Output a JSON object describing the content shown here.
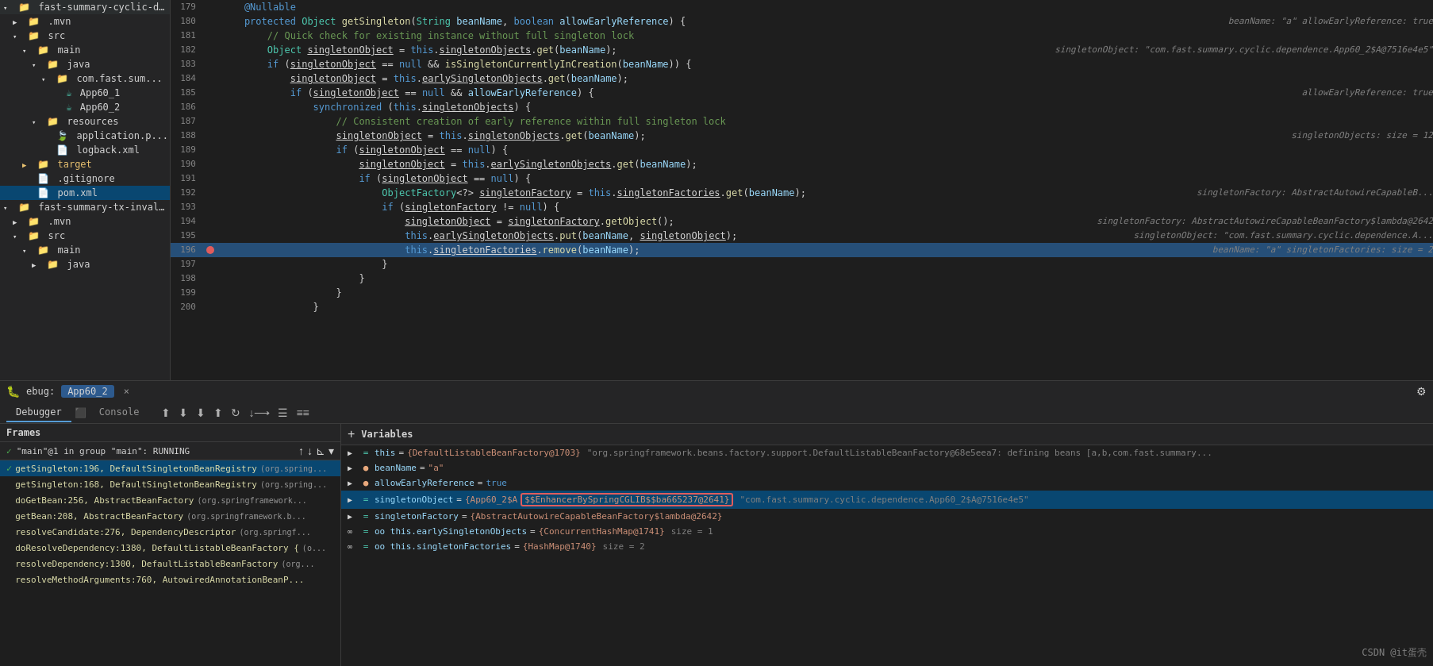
{
  "sidebar": {
    "items": [
      {
        "id": "fast-summary-cyclic",
        "label": "fast-summary-cyclic-de...",
        "indent": 0,
        "type": "folder",
        "expanded": true,
        "color": "orange"
      },
      {
        "id": "mvn1",
        "label": ".mvn",
        "indent": 1,
        "type": "folder",
        "expanded": false
      },
      {
        "id": "src1",
        "label": "src",
        "indent": 1,
        "type": "folder",
        "expanded": true
      },
      {
        "id": "main1",
        "label": "main",
        "indent": 2,
        "type": "folder",
        "expanded": true
      },
      {
        "id": "java1",
        "label": "java",
        "indent": 3,
        "type": "folder",
        "expanded": true
      },
      {
        "id": "com.fast.sum",
        "label": "com.fast.sum...",
        "indent": 4,
        "type": "folder",
        "expanded": true
      },
      {
        "id": "App60_1",
        "label": "App60_1",
        "indent": 5,
        "type": "java"
      },
      {
        "id": "App60_2",
        "label": "App60_2",
        "indent": 5,
        "type": "java"
      },
      {
        "id": "resources",
        "label": "resources",
        "indent": 3,
        "type": "folder",
        "expanded": true
      },
      {
        "id": "application.p",
        "label": "application.p...",
        "indent": 4,
        "type": "prop"
      },
      {
        "id": "logback.xml",
        "label": "logback.xml",
        "indent": 4,
        "type": "xml"
      },
      {
        "id": "target",
        "label": "target",
        "indent": 2,
        "type": "folder-orange",
        "expanded": false
      },
      {
        "id": "gitignore",
        "label": ".gitignore",
        "indent": 2,
        "type": "file"
      },
      {
        "id": "pom.xml",
        "label": "pom.xml",
        "indent": 2,
        "type": "maven",
        "selected": true
      },
      {
        "id": "fast-summary-tx-invalid",
        "label": "fast-summary-tx-invali...",
        "indent": 0,
        "type": "folder",
        "expanded": true
      },
      {
        "id": "mvn2",
        "label": ".mvn",
        "indent": 1,
        "type": "folder"
      },
      {
        "id": "src2",
        "label": "src",
        "indent": 1,
        "type": "folder",
        "expanded": true
      },
      {
        "id": "main2",
        "label": "main",
        "indent": 2,
        "type": "folder",
        "expanded": true
      },
      {
        "id": "java2",
        "label": "java",
        "indent": 3,
        "type": "folder",
        "expanded": false
      }
    ]
  },
  "code": {
    "lines": [
      {
        "num": 179,
        "content": "    @Nullable",
        "type": "annotation",
        "highlighted": false
      },
      {
        "num": 180,
        "content": "    protected Object getSingleton(String beanName, boolean allowEarlyReference) {",
        "highlighted": false,
        "hint": "  beanName: \"a\"    allowEarlyReference: true"
      },
      {
        "num": 181,
        "content": "        // Quick check for existing instance without full singleton lock",
        "highlighted": false
      },
      {
        "num": 182,
        "content": "        Object singletonObject = this.singletonObjects.get(beanName);",
        "highlighted": false,
        "hint": "  singletonObject: \"com.fast.summary.cyclic.dependence.App60_2$A@7516e4e5\""
      },
      {
        "num": 183,
        "content": "        if (singletonObject == null && isSingletonCurrentlyInCreation(beanName)) {",
        "highlighted": false
      },
      {
        "num": 184,
        "content": "            singletonObject = this.earlySingletonObjects.get(beanName);",
        "highlighted": false
      },
      {
        "num": 185,
        "content": "            if (singletonObject == null && allowEarlyReference) {",
        "highlighted": false,
        "hint": "  allowEarlyReference: true"
      },
      {
        "num": 186,
        "content": "                synchronized (this.singletonObjects) {",
        "highlighted": false
      },
      {
        "num": 187,
        "content": "                    // Consistent creation of early reference within full singleton lock",
        "highlighted": false
      },
      {
        "num": 188,
        "content": "                    singletonObject = this.singletonObjects.get(beanName);",
        "highlighted": false,
        "hint": "  singletonObjects:  size = 12"
      },
      {
        "num": 189,
        "content": "                    if (singletonObject == null) {",
        "highlighted": false
      },
      {
        "num": 190,
        "content": "                        singletonObject = this.earlySingletonObjects.get(beanName);",
        "highlighted": false
      },
      {
        "num": 191,
        "content": "                        if (singletonObject == null) {",
        "highlighted": false
      },
      {
        "num": 192,
        "content": "                            ObjectFactory<?> singletonFactory = this.singletonFactories.get(beanName);",
        "highlighted": false,
        "hint": "  singletonFactory: AbstractAutowireCapableB"
      },
      {
        "num": 193,
        "content": "                            if (singletonFactory != null) {",
        "highlighted": false
      },
      {
        "num": 194,
        "content": "                                singletonObject = singletonFactory.getObject();",
        "highlighted": false,
        "hint": "  singletonFactory: AbstractAutowireCapableBeanFactory$lambda@2642"
      },
      {
        "num": 195,
        "content": "                                this.earlySingletonObjects.put(beanName, singletonObject);",
        "highlighted": false,
        "hint": "  singletonObject: \"com.fast.summary.cyclic.dependence.A"
      },
      {
        "num": 196,
        "content": "                                this.singletonFactories.remove(beanName);",
        "highlighted": true,
        "breakpoint": true,
        "hint": "  beanName: \"a\"    singletonFactories:  size = 2"
      },
      {
        "num": 197,
        "content": "                            }",
        "highlighted": false
      },
      {
        "num": 198,
        "content": "                        }",
        "highlighted": false
      },
      {
        "num": 199,
        "content": "                    }",
        "highlighted": false
      },
      {
        "num": 200,
        "content": "                }",
        "highlighted": false
      }
    ]
  },
  "debug": {
    "title": "ebug:",
    "tab_icon": "🐛",
    "tab_label": "App60_2",
    "gear_label": "⚙",
    "tabs": [
      {
        "label": "Debugger",
        "active": true
      },
      {
        "label": "Console",
        "active": false
      }
    ],
    "toolbar_btns": [
      "▲",
      "↓",
      "↓",
      "↑",
      "↻",
      "↓⟶",
      "☰",
      "≡≡"
    ],
    "frames_header": "Frames",
    "variables_header": "Variables",
    "thread": {
      "check": "✓",
      "name": "\"main\"@1 in group \"main\": RUNNING"
    },
    "frames": [
      {
        "method": "getSingleton:196, DefaultSingletonBeanRegistry",
        "info": "(org.spring...",
        "selected": true
      },
      {
        "method": "getSingleton:168, DefaultSingletonBeanRegistry",
        "info": "(org.spring..."
      },
      {
        "method": "doGetBean:256, AbstractBeanFactory",
        "info": "(org.springframework..."
      },
      {
        "method": "getBean:208, AbstractBeanFactory",
        "info": "(org.springframework.b..."
      },
      {
        "method": "resolveCandidate:276, DependencyDescriptor",
        "info": "(org.springf..."
      },
      {
        "method": "doResolveDependency:1380, DefaultListableBeanFactory {",
        "info": "(o..."
      },
      {
        "method": "resolveDependency:1300, DefaultListableBeanFactory",
        "info": "(org..."
      },
      {
        "method": "resolveMethodArguments:760, AutowiredAnnotationBeanP...",
        "info": ""
      }
    ],
    "variables": [
      {
        "indent": 0,
        "expand": "▶",
        "icon": "=",
        "icon_color": "green",
        "name": "this",
        "eq": "=",
        "val": "{DefaultListableBeanFactory@1703}",
        "extra": " \"org.springframework.beans.factory.support.DefaultListableBeanFactory@68e5eea7: defining beans [a,b,com.fast.summary...",
        "selected": false
      },
      {
        "indent": 0,
        "expand": "▶",
        "icon": "●",
        "icon_color": "orange",
        "name": "beanName",
        "eq": "=",
        "val": "\"a\"",
        "selected": false
      },
      {
        "indent": 0,
        "expand": "▶",
        "icon": "●",
        "icon_color": "orange",
        "name": "allowEarlyReference",
        "eq": "=",
        "val": "true",
        "val_type": "bool",
        "selected": false
      },
      {
        "indent": 0,
        "expand": "▶",
        "icon": "=",
        "icon_color": "green",
        "name": "singletonObject",
        "eq": "=",
        "val_prefix": "{App60_2$A",
        "val_highlight": "$$EnhancerBySpringCGLIB$$ba665237@2641}",
        "val_suffix": " \"com.fast.summary.cyclic.dependence.App60_2$A@7516e4e5\"",
        "selected": true,
        "highlighted": true
      },
      {
        "indent": 0,
        "expand": "▶",
        "icon": "=",
        "icon_color": "green",
        "name": "singletonFactory",
        "eq": "=",
        "val": "{AbstractAutowireCapableBeanFactory$lambda@2642}",
        "selected": false
      },
      {
        "indent": 0,
        "expand": "∞",
        "icon": "=",
        "icon_color": "green",
        "name": "this.earlySingletonObjects",
        "eq": "=",
        "val": "{ConcurrentHashMap@1741}",
        "extra": " size = 1",
        "selected": false,
        "prefix": "oo "
      },
      {
        "indent": 0,
        "expand": "∞",
        "icon": "=",
        "icon_color": "green",
        "name": "this.singletonFactories",
        "eq": "=",
        "val": "{HashMap@1740}",
        "extra": " size = 2",
        "selected": false,
        "prefix": "oo "
      }
    ]
  },
  "watermark": "CSDN @it蛋壳"
}
